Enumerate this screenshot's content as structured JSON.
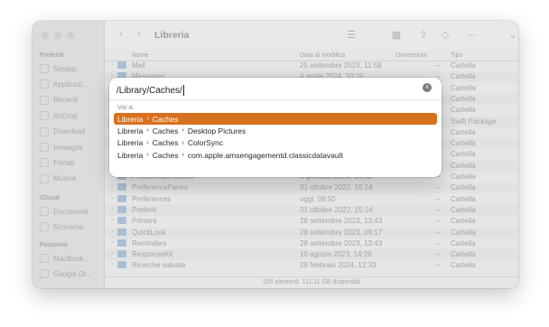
{
  "window": {
    "title": "Libreria"
  },
  "sidebar": {
    "sections": [
      {
        "label": "Preferiti",
        "items": [
          "Setapp",
          "Applicazi...",
          "Recenti",
          "AirDrop",
          "Download",
          "Immagini",
          "Filmati",
          "Musica"
        ]
      },
      {
        "label": "iCloud",
        "items": [
          "Documenti",
          "Scrivania"
        ]
      },
      {
        "label": "Posizioni",
        "items": [
          "MacBook...",
          "Google Dr..."
        ]
      }
    ]
  },
  "columns": {
    "name": "Nome",
    "date": "Data di modifica",
    "size": "Dimensioni",
    "kind": "Tipo"
  },
  "rows": [
    {
      "name": "Mail",
      "date": "25 settembre 2023, 11:58",
      "size": "--",
      "kind": "Cartella"
    },
    {
      "name": "Messages",
      "date": "4 aprile 2024, 10:26",
      "size": "--",
      "kind": "Cartella"
    },
    {
      "name": "",
      "date": "",
      "size": "--",
      "kind": "Cartella"
    },
    {
      "name": "",
      "date": "",
      "size": "--",
      "kind": "Cartella"
    },
    {
      "name": "",
      "date": "",
      "size": "--",
      "kind": "Cartella"
    },
    {
      "name": "",
      "date": "",
      "size": "--",
      "kind": "Swift Package"
    },
    {
      "name": "",
      "date": "",
      "size": "--",
      "kind": "Cartella"
    },
    {
      "name": "",
      "date": "",
      "size": "--",
      "kind": "Cartella"
    },
    {
      "name": "",
      "date": "",
      "size": "--",
      "kind": "Cartella"
    },
    {
      "name": "",
      "date": "",
      "size": "--",
      "kind": "Cartella"
    },
    {
      "name": "PhotoshopCrashes",
      "date": "8 gennaio 2024, 14:53",
      "size": "--",
      "kind": "Cartella"
    },
    {
      "name": "PreferencePanes",
      "date": "31 ottobre 2022, 15:14",
      "size": "--",
      "kind": "Cartella"
    },
    {
      "name": "Preferences",
      "date": "oggi, 09:50",
      "size": "--",
      "kind": "Cartella"
    },
    {
      "name": "Preferiti",
      "date": "31 ottobre 2022, 15:14",
      "size": "--",
      "kind": "Cartella"
    },
    {
      "name": "Printers",
      "date": "28 settembre 2023, 13:43",
      "size": "--",
      "kind": "Cartella"
    },
    {
      "name": "QuickLook",
      "date": "28 settembre 2023, 09:17",
      "size": "--",
      "kind": "Cartella"
    },
    {
      "name": "Reminders",
      "date": "28 settembre 2023, 13:43",
      "size": "--",
      "kind": "Cartella"
    },
    {
      "name": "ResponseKit",
      "date": "10 agosto 2023, 14:26",
      "size": "--",
      "kind": "Cartella"
    },
    {
      "name": "Ricerche salvate",
      "date": "28 febbraio 2024, 12:33",
      "size": "--",
      "kind": "Cartella"
    }
  ],
  "status": "105 elementi, 111,11 GB disponibili",
  "goto": {
    "value": "/Library/Caches/",
    "section_label": "Vai a:",
    "suggestions": [
      {
        "parts": [
          "Libreria",
          "Caches"
        ],
        "selected": true
      },
      {
        "parts": [
          "Libreria",
          "Caches",
          "Desktop Pictures"
        ],
        "selected": false
      },
      {
        "parts": [
          "Libreria",
          "Caches",
          "ColorSync"
        ],
        "selected": false
      },
      {
        "parts": [
          "Libreria",
          "Caches",
          "com.apple.amsengagementd.classicdatavault"
        ],
        "selected": false
      }
    ]
  },
  "colors": {
    "accent": "#d8711e",
    "folder": "#a9bfd5"
  },
  "icons": {
    "separator": "›",
    "clear": "x"
  }
}
